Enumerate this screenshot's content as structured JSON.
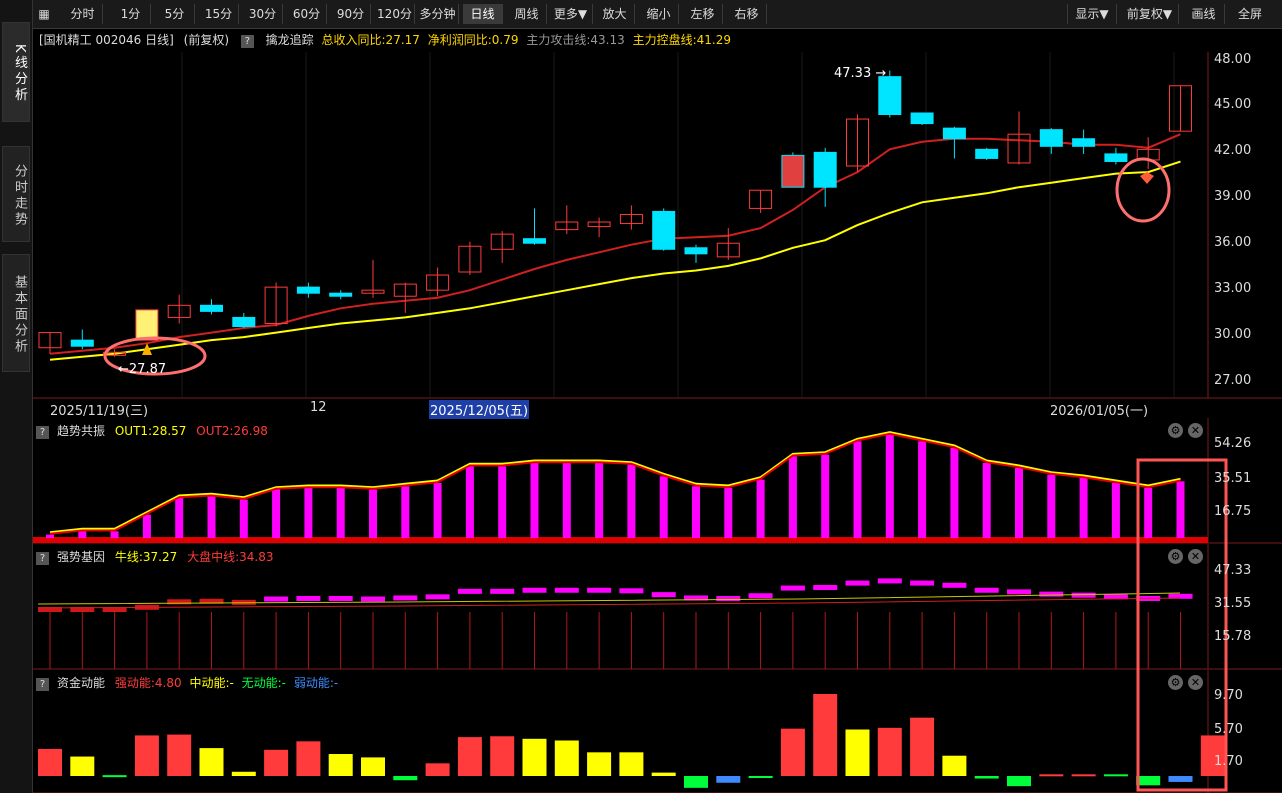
{
  "sidebar": {
    "tabs": [
      {
        "label": "K线分析"
      },
      {
        "label": "分时走势"
      },
      {
        "label": "基本面分析"
      }
    ]
  },
  "toolbar": {
    "periods": [
      "分时",
      "1分",
      "5分",
      "15分",
      "30分",
      "60分",
      "90分",
      "120分",
      "多分钟",
      "日线",
      "周线",
      "更多▼"
    ],
    "active_period": "日线",
    "actions": [
      "放大",
      "缩小",
      "左移",
      "右移"
    ],
    "right": [
      "显示▼",
      "前复权▼",
      "画线",
      "全屏"
    ]
  },
  "info": {
    "stock": "[国机精工 002046 日线]",
    "adjust": "(前复权)",
    "indicator": "擒龙追踪",
    "revenue": "总收入同比:27.17",
    "profit": "净利润同比:0.79",
    "attack": "主力攻击线:43.13",
    "control": "主力控盘线:41.29"
  },
  "colors": {
    "up": "#ff3b3b",
    "down": "#00e5ff",
    "yellow": "#ffff00",
    "magenta": "#ff00ff",
    "green": "#00ff3b",
    "blue": "#3d8bff",
    "circle": "#ff6f6f"
  },
  "chart_data": [
    {
      "type": "candlestick",
      "name": "price",
      "ylim": [
        27.0,
        48.0
      ],
      "yticks": [
        "48.00",
        "45.00",
        "42.00",
        "39.00",
        "36.00",
        "33.00",
        "30.00",
        "27.00"
      ],
      "x_labels": [
        "2025/11/19(三)",
        "12",
        "2025/12/05(五)",
        "2026/01/05(一)"
      ],
      "high_label": "47.33",
      "low_label": "27.87",
      "candles": [
        [
          29.0,
          30.0,
          28.6,
          30.0
        ],
        [
          29.5,
          29.1,
          28.9,
          30.2
        ],
        [
          28.5,
          28.7,
          28.4,
          28.9
        ],
        [
          29.5,
          31.5,
          29.5,
          31.5
        ],
        [
          31.0,
          31.8,
          30.6,
          32.5
        ],
        [
          31.8,
          31.4,
          31.2,
          32.2
        ],
        [
          31.0,
          30.4,
          30.3,
          31.3
        ],
        [
          30.6,
          33.0,
          30.4,
          33.3
        ],
        [
          33.0,
          32.6,
          32.3,
          33.3
        ],
        [
          32.6,
          32.4,
          32.2,
          32.8
        ],
        [
          32.6,
          32.8,
          32.3,
          34.8
        ],
        [
          32.4,
          33.2,
          31.3,
          33.3
        ],
        [
          32.8,
          33.8,
          32.4,
          34.3
        ],
        [
          34.0,
          35.7,
          33.8,
          36.0
        ],
        [
          35.5,
          36.5,
          34.6,
          36.7
        ],
        [
          36.2,
          35.9,
          35.8,
          38.2
        ],
        [
          36.8,
          37.3,
          36.5,
          38.4
        ],
        [
          37.0,
          37.3,
          36.3,
          37.6
        ],
        [
          37.2,
          37.8,
          36.8,
          38.4
        ],
        [
          38.0,
          35.5,
          35.4,
          38.2
        ],
        [
          35.6,
          35.2,
          34.6,
          35.8
        ],
        [
          35.0,
          35.9,
          34.8,
          36.9
        ],
        [
          38.2,
          39.4,
          37.9,
          39.4
        ],
        [
          41.7,
          39.6,
          39.6,
          41.9
        ],
        [
          41.9,
          39.6,
          38.3,
          42.2
        ],
        [
          41.0,
          44.1,
          40.6,
          44.4
        ],
        [
          46.9,
          44.4,
          44.2,
          47.3
        ],
        [
          44.5,
          43.8,
          43.7,
          44.5
        ],
        [
          43.5,
          42.8,
          41.5,
          43.6
        ],
        [
          42.1,
          41.5,
          41.4,
          42.2
        ],
        [
          41.2,
          43.1,
          41.1,
          44.6
        ],
        [
          43.4,
          42.3,
          41.8,
          43.5
        ],
        [
          42.8,
          42.3,
          41.8,
          43.4
        ],
        [
          41.8,
          41.3,
          41.1,
          42.2
        ],
        [
          41.4,
          42.1,
          40.8,
          42.9
        ],
        [
          43.3,
          46.3,
          43.3,
          46.3
        ]
      ],
      "ma_red": [
        28.6,
        28.8,
        29.0,
        29.3,
        29.7,
        30.0,
        30.3,
        30.5,
        31.1,
        31.6,
        31.9,
        32.1,
        32.3,
        32.8,
        33.5,
        34.2,
        34.8,
        35.3,
        35.8,
        36.2,
        36.3,
        36.4,
        36.9,
        38.1,
        39.6,
        40.6,
        42.1,
        42.6,
        42.8,
        42.8,
        42.7,
        42.6,
        42.4,
        42.4,
        42.2,
        43.1
      ],
      "ma_yellow": [
        28.2,
        28.4,
        28.6,
        28.9,
        29.2,
        29.5,
        29.7,
        30.0,
        30.3,
        30.6,
        30.8,
        31.0,
        31.3,
        31.6,
        32.0,
        32.4,
        32.8,
        33.2,
        33.6,
        33.9,
        34.1,
        34.4,
        34.9,
        35.6,
        36.1,
        37.1,
        37.9,
        38.6,
        38.9,
        39.2,
        39.6,
        39.9,
        40.2,
        40.5,
        40.6,
        41.29
      ]
    },
    {
      "type": "bar",
      "name": "trend",
      "title": "趋势共振",
      "out1_label": "OUT1:28.57",
      "out2_label": "OUT2:26.98",
      "yticks": [
        "54.26",
        "35.51",
        "16.75"
      ],
      "ylim": [
        0,
        60
      ],
      "values": [
        2,
        4,
        4,
        14,
        24,
        25,
        23,
        29,
        30,
        30,
        29,
        31,
        33,
        43,
        43,
        45,
        45,
        45,
        44,
        37,
        31,
        30,
        35,
        49,
        50,
        58,
        62,
        58,
        54,
        45,
        42,
        38,
        36,
        33,
        30,
        34
      ]
    },
    {
      "type": "bar",
      "name": "strong_gene",
      "title": "强势基因",
      "bull_label": "牛线:37.27",
      "market_label": "大盘中线:34.83",
      "yticks": [
        "47.33",
        "31.55",
        "15.78"
      ]
    },
    {
      "type": "bar",
      "name": "fund",
      "title": "资金动能",
      "strong_label": "强动能:4.80",
      "mid_label": "中动能:-",
      "none_label": "无动能:-",
      "weak_label": "弱动能:-",
      "yticks": [
        "9.70",
        "5.70",
        "1.70"
      ],
      "ylim": [
        -1.5,
        10.5
      ],
      "bars": [
        [
          3.2,
          "red"
        ],
        [
          2.3,
          "yellow"
        ],
        [
          0.1,
          "green"
        ],
        [
          4.8,
          "red"
        ],
        [
          4.9,
          "red"
        ],
        [
          3.3,
          "yellow"
        ],
        [
          0.5,
          "yellow"
        ],
        [
          3.1,
          "red"
        ],
        [
          4.1,
          "red"
        ],
        [
          2.6,
          "yellow"
        ],
        [
          2.2,
          "yellow"
        ],
        [
          -0.5,
          "green"
        ],
        [
          1.5,
          "red"
        ],
        [
          4.6,
          "red"
        ],
        [
          4.7,
          "red"
        ],
        [
          4.4,
          "yellow"
        ],
        [
          4.2,
          "yellow"
        ],
        [
          2.8,
          "yellow"
        ],
        [
          2.8,
          "yellow"
        ],
        [
          0.4,
          "yellow"
        ],
        [
          -1.4,
          "green"
        ],
        [
          -0.8,
          "blue"
        ],
        [
          0,
          "green"
        ],
        [
          5.6,
          "red"
        ],
        [
          9.7,
          "red"
        ],
        [
          5.5,
          "yellow"
        ],
        [
          5.7,
          "red"
        ],
        [
          6.9,
          "red"
        ],
        [
          2.4,
          "yellow"
        ],
        [
          -0.3,
          "green"
        ],
        [
          -1.2,
          "green"
        ],
        [
          0.2,
          "red"
        ],
        [
          0.2,
          "red"
        ],
        [
          0.2,
          "green"
        ],
        [
          -1.1,
          "green"
        ],
        [
          -0.7,
          "blue"
        ],
        [
          4.8,
          "red"
        ]
      ]
    }
  ]
}
